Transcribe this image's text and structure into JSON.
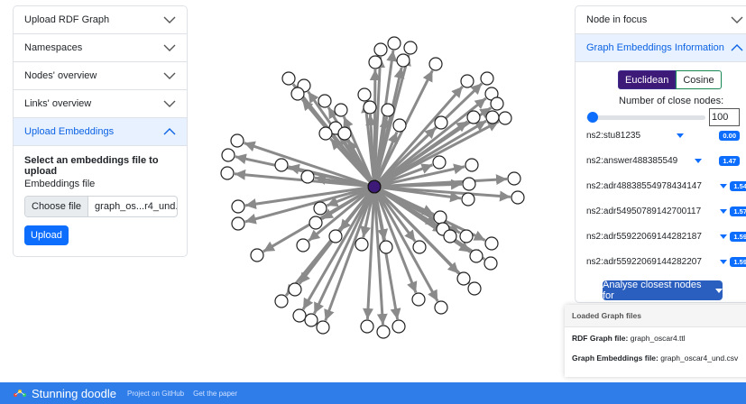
{
  "left_panel": {
    "items": [
      {
        "label": "Upload RDF Graph"
      },
      {
        "label": "Namespaces"
      },
      {
        "label": "Nodes' overview"
      },
      {
        "label": "Links' overview"
      },
      {
        "label": "Upload Embeddings"
      }
    ],
    "upload": {
      "title": "Select an embeddings file to upload",
      "label": "Embeddings file",
      "choose_label": "Choose file",
      "file_name": "graph_os...r4_und.csv",
      "button": "Upload"
    }
  },
  "right_panel": {
    "node_in_focus": "Node in focus",
    "embeddings_info": "Graph Embeddings Information",
    "metric_euclidean": "Euclidean",
    "metric_cosine": "Cosine",
    "close_nodes_label": "Number of close nodes:",
    "close_nodes_value": "100",
    "slider_value": 0.05,
    "nodes": [
      {
        "name": "ns2:stu81235",
        "distance": "0.00"
      },
      {
        "name": "ns2:answer488385549",
        "distance": "1.47"
      },
      {
        "name": "ns2:adr48838554978434147",
        "distance": "1.54"
      },
      {
        "name": "ns2:adr54950789142700117",
        "distance": "1.57"
      },
      {
        "name": "ns2:adr55922069144282187",
        "distance": "1.59"
      },
      {
        "name": "ns2:adr55922069144282207",
        "distance": "1.59"
      }
    ],
    "analyse_button": "Analyse closest nodes for"
  },
  "loaded_files": {
    "title": "Loaded Graph files",
    "rdf_label": "RDF Graph file:",
    "rdf_value": "graph_oscar4.ttl",
    "emb_label": "Graph Embeddings file:",
    "emb_value": "graph_oscar4_und.csv"
  },
  "footer": {
    "brand": "Stunning doodle",
    "link_github": "Project on GitHub",
    "link_paper": "Get the paper"
  },
  "colors": {
    "accent": "#0d6efd",
    "footer": "#2f7de8",
    "focus_node": "#3d1a78",
    "edge": "#8a8a8a"
  }
}
